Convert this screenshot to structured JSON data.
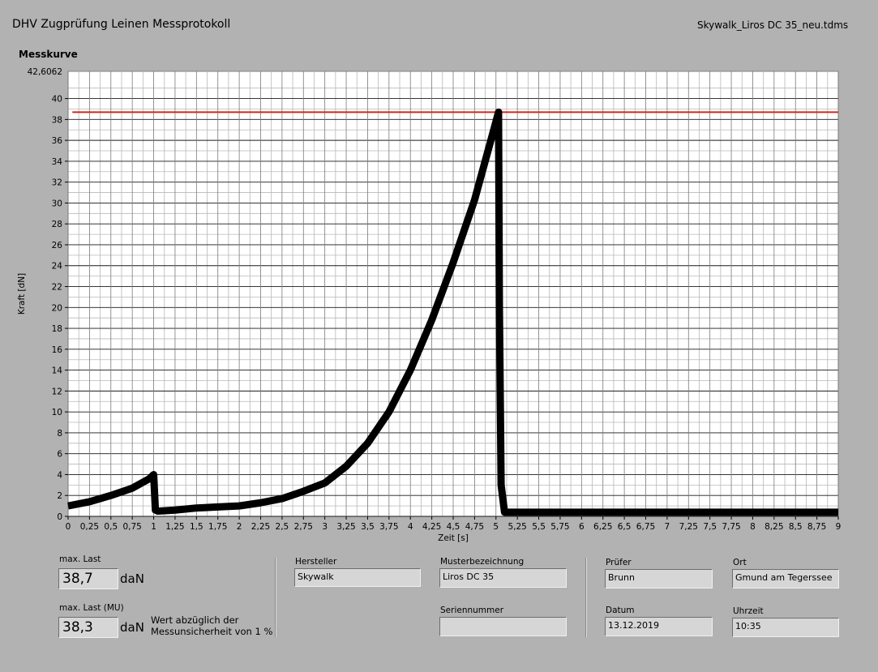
{
  "header": {
    "title": "DHV Zugprüfung Leinen Messprotokoll",
    "filename": "Skywalk_Liros DC 35_neu.tdms",
    "chart_label": "Messkurve"
  },
  "chart_data": {
    "type": "line",
    "xlabel": "Zeit [s]",
    "ylabel": "Kraft [dN]",
    "xlim": [
      0,
      9
    ],
    "ylim": [
      0,
      42.6062
    ],
    "y_top_label": "42,6062",
    "x_ticks": [
      "0",
      "0,25",
      "0,5",
      "0,75",
      "1",
      "1,25",
      "1,5",
      "1,75",
      "2",
      "2,25",
      "2,5",
      "2,75",
      "3",
      "3,25",
      "3,5",
      "3,75",
      "4",
      "4,25",
      "4,5",
      "4,75",
      "5",
      "5,25",
      "5,5",
      "5,75",
      "6",
      "6,25",
      "6,5",
      "6,75",
      "7",
      "7,25",
      "7,5",
      "7,75",
      "8",
      "8,25",
      "8,5",
      "8,75",
      "9"
    ],
    "y_ticks": [
      "0",
      "2",
      "4",
      "6",
      "8",
      "10",
      "12",
      "14",
      "16",
      "18",
      "20",
      "22",
      "24",
      "26",
      "28",
      "30",
      "32",
      "34",
      "36",
      "38",
      "40"
    ],
    "reference_line": {
      "value": 38.7,
      "color": "#cc2a1e"
    },
    "series": [
      {
        "color": "#000000",
        "x": [
          0,
          0.25,
          0.5,
          0.75,
          0.95,
          1.0,
          1.02,
          1.05,
          1.25,
          1.5,
          1.75,
          2.0,
          2.25,
          2.5,
          2.75,
          3.0,
          3.25,
          3.5,
          3.75,
          4.0,
          4.25,
          4.5,
          4.75,
          4.95,
          5.03,
          5.04,
          5.06,
          5.1,
          5.5,
          6.0,
          6.5,
          7.0,
          7.5,
          8.0,
          8.5,
          9.0
        ],
        "y": [
          1.0,
          1.4,
          2.0,
          2.7,
          3.6,
          4.0,
          0.6,
          0.5,
          0.6,
          0.8,
          0.9,
          1.0,
          1.3,
          1.7,
          2.4,
          3.2,
          4.8,
          7.0,
          10.0,
          14.0,
          18.8,
          24.3,
          30.3,
          36.3,
          38.7,
          20.0,
          3.0,
          0.4,
          0.4,
          0.4,
          0.4,
          0.4,
          0.4,
          0.4,
          0.4,
          0.4
        ]
      }
    ],
    "grid": true
  },
  "results": {
    "max_last_label": "max. Last",
    "max_last_value": "38,7",
    "max_last_unit": "daN",
    "max_last_mu_label": "max. Last (MU)",
    "max_last_mu_value": "38,3",
    "max_last_mu_unit": "daN",
    "mu_note_line1": "Wert abzüglich der",
    "mu_note_line2": "Messunsicherheit von 1 %"
  },
  "fields": {
    "hersteller_label": "Hersteller",
    "hersteller_value": "Skywalk",
    "muster_label": "Musterbezeichnung",
    "muster_value": "Liros DC 35",
    "serien_label": "Seriennummer",
    "serien_value": "",
    "pruefer_label": "Prüfer",
    "pruefer_value": "Brunn",
    "ort_label": "Ort",
    "ort_value": "Gmund am Tegerssee",
    "datum_label": "Datum",
    "datum_value": "13.12.2019",
    "uhrzeit_label": "Uhrzeit",
    "uhrzeit_value": "10:35"
  }
}
